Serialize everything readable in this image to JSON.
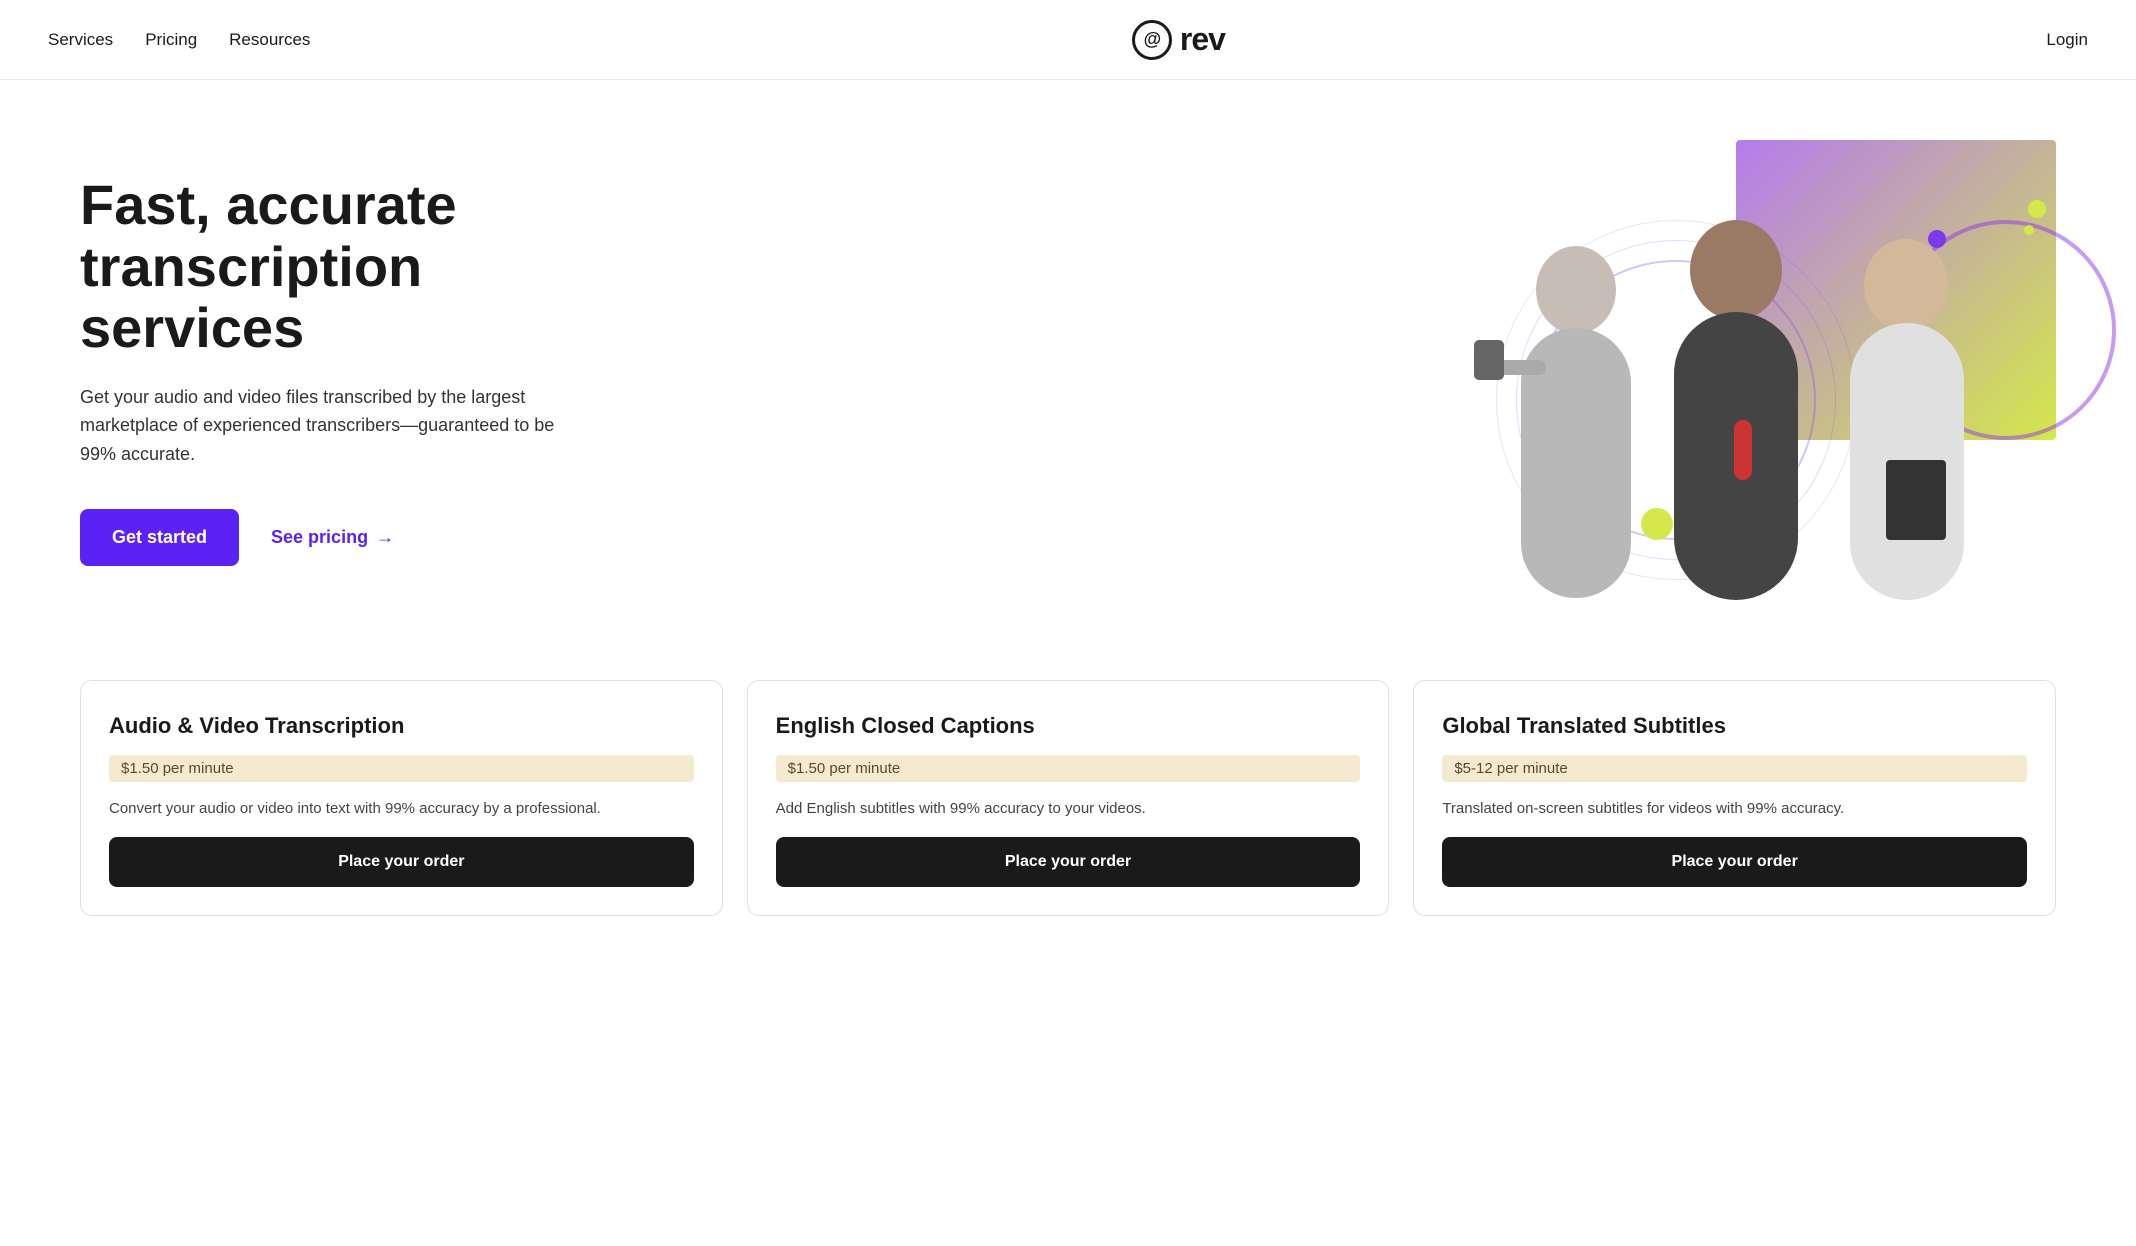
{
  "header": {
    "nav": [
      {
        "label": "Services",
        "id": "nav-services"
      },
      {
        "label": "Pricing",
        "id": "nav-pricing"
      },
      {
        "label": "Resources",
        "id": "nav-resources"
      }
    ],
    "logo_symbol": "@",
    "logo_text": "rev",
    "login_label": "Login"
  },
  "hero": {
    "title": "Fast, accurate transcription services",
    "description": "Get your audio and video files transcribed by the largest marketplace of experienced transcribers—guaranteed to be 99% accurate.",
    "cta_primary": "Get started",
    "cta_secondary": "See pricing",
    "arrow": "→"
  },
  "services": {
    "cards": [
      {
        "title": "Audio & Video Transcription",
        "price": "$1.50 per minute",
        "description": "Convert your audio or video into text with 99% accuracy by a professional.",
        "cta": "Place your order"
      },
      {
        "title": "English Closed Captions",
        "price": "$1.50 per minute",
        "description": "Add English subtitles with 99% accuracy to your videos.",
        "cta": "Place your order"
      },
      {
        "title": "Global Translated Subtitles",
        "price": "$5-12 per minute",
        "description": "Translated on-screen subtitles for videos with 99% accuracy.",
        "cta": "Place your order"
      }
    ]
  }
}
